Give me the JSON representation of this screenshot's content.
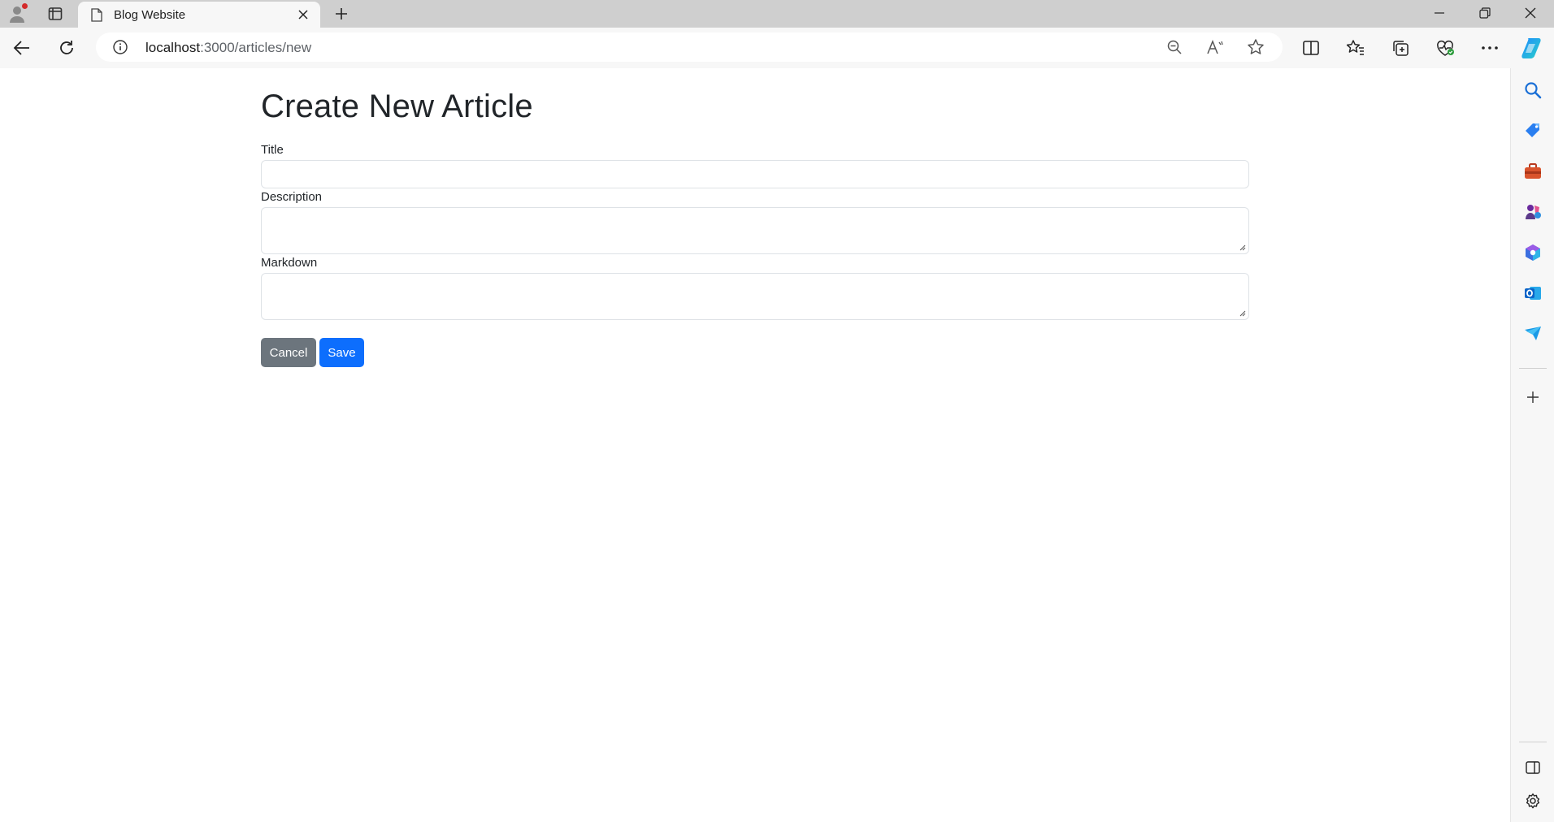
{
  "browser": {
    "tab": {
      "title": "Blog Website"
    },
    "address_bar": {
      "host": "localhost",
      "path": ":3000/articles/new"
    }
  },
  "page": {
    "heading": "Create New Article",
    "form": {
      "title_label": "Title",
      "title_value": "",
      "description_label": "Description",
      "description_value": "",
      "markdown_label": "Markdown",
      "markdown_value": "",
      "cancel_label": "Cancel",
      "save_label": "Save"
    }
  },
  "colors": {
    "cancel_button": "#6c757d",
    "save_button": "#0d6efd",
    "profile_notification": "#d42b2b"
  },
  "icons": {
    "titlebar": [
      "profile-icon",
      "tab-actions-icon",
      "page-icon",
      "close-icon",
      "new-tab-icon",
      "minimize-icon",
      "restore-icon",
      "window-close-icon"
    ],
    "toolbar": [
      "back-icon",
      "refresh-icon",
      "info-icon",
      "zoom-out-icon",
      "read-aloud-icon",
      "favorite-star-icon",
      "split-screen-icon",
      "favorites-icon",
      "collections-icon",
      "browser-essentials-icon",
      "more-icon",
      "copilot-icon"
    ],
    "sidebar": [
      "search-icon",
      "shopping-icon",
      "tools-icon",
      "games-icon",
      "microsoft365-icon",
      "outlook-icon",
      "drop-icon",
      "add-icon",
      "hide-sidebar-icon",
      "settings-icon"
    ]
  }
}
